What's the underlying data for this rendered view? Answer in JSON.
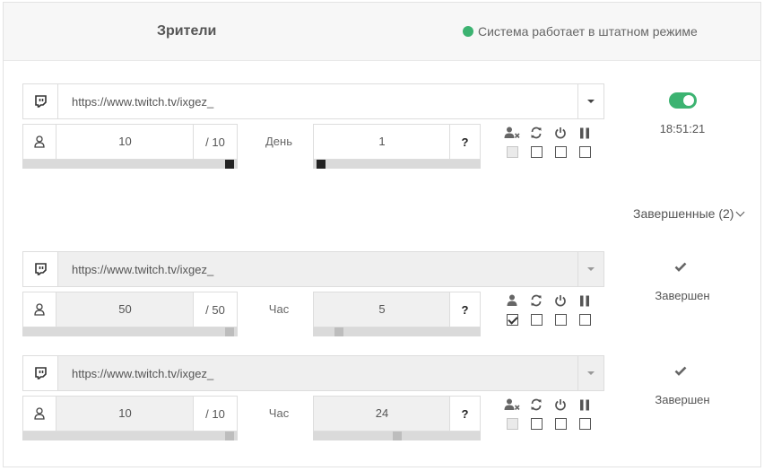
{
  "header": {
    "title": "Зрители",
    "status_text": "Система работает в штатном режиме",
    "status_color": "#3cb371"
  },
  "finished_section": {
    "label": "Завершенные (2)"
  },
  "tasks": [
    {
      "url": "https://www.twitch.tv/ixgez_",
      "viewers": "10",
      "viewers_max": "/ 10",
      "viewers_fill": 1.0,
      "period_unit": "День",
      "period_value": "1",
      "period_help": "?",
      "period_fill": 0.0,
      "options": [
        "user-x-icon",
        "refresh-icon",
        "power-icon",
        "pause-icon"
      ],
      "option_checked": [
        false,
        false,
        false,
        false
      ],
      "option_disabled": [
        true,
        false,
        false,
        false
      ],
      "active": true,
      "time": "18:51:21"
    },
    {
      "url": "https://www.twitch.tv/ixgez_",
      "viewers": "50",
      "viewers_max": "/ 50",
      "viewers_fill": 1.0,
      "period_unit": "Час",
      "period_value": "5",
      "period_help": "?",
      "period_fill": 0.12,
      "options": [
        "user-icon",
        "refresh-icon",
        "power-icon",
        "pause-icon"
      ],
      "option_checked": [
        true,
        false,
        false,
        false
      ],
      "option_disabled": [
        false,
        false,
        false,
        false
      ],
      "status_text": "Завершен"
    },
    {
      "url": "https://www.twitch.tv/ixgez_",
      "viewers": "10",
      "viewers_max": "/ 10",
      "viewers_fill": 1.0,
      "period_unit": "Час",
      "period_value": "24",
      "period_help": "?",
      "period_fill": 0.5,
      "options": [
        "user-x-icon",
        "refresh-icon",
        "power-icon",
        "pause-icon"
      ],
      "option_checked": [
        false,
        false,
        false,
        false
      ],
      "option_disabled": [
        true,
        false,
        false,
        false
      ],
      "status_text": "Завершен"
    }
  ]
}
